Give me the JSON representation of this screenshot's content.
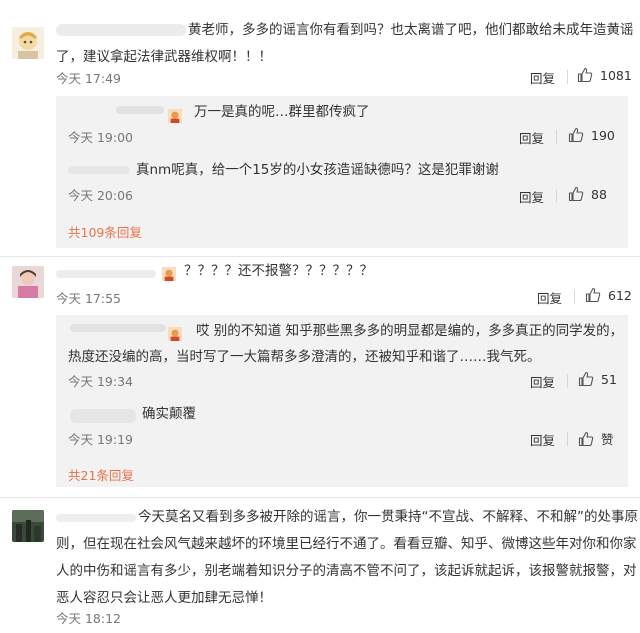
{
  "comments": [
    {
      "text_line1": "黄老师，多多的谣言你有看到吗？也太离谱了吧，他们都敢给未成年造黄谣",
      "text_line2": "了，建议拿起法律武器维权啊！！！",
      "time": "今天 17:49",
      "reply_label": "回复",
      "likes": "1081",
      "replies": [
        {
          "text": "万一是真的呢…群里都传疯了",
          "time": "今天 19:00",
          "reply_label": "回复",
          "likes": "190"
        },
        {
          "text": "真nm呢真，给一个15岁的小女孩造谣缺德吗？这是犯罪谢谢",
          "time": "今天 20:06",
          "reply_label": "回复",
          "likes": "88"
        }
      ],
      "more_replies": "共109条回复"
    },
    {
      "text_line1": "？？？？还不报警？？？？？？",
      "time": "今天 17:55",
      "reply_label": "回复",
      "likes": "612",
      "replies": [
        {
          "text_line1": "哎 别的不知道 知乎那些黑多多的明显都是编的，多多真正的同学发的，",
          "text_line2": "热度还没编的高，当时写了一大篇帮多多澄清的，还被知乎和谐了……我气死。",
          "time": "今天 19:34",
          "reply_label": "回复",
          "likes": "51"
        },
        {
          "text": "确实颠覆",
          "time": "今天 19:19",
          "reply_label": "回复",
          "likes": "赞"
        }
      ],
      "more_replies": "共21条回复"
    },
    {
      "text_line1": "今天莫名又看到多多被开除的谣言，你一贯秉持“不宣战、不解释、不和解”的处事原",
      "text_line2": "则，但在现在社会风气越来越坏的环境里已经行不通了。看看豆瓣、知乎、微博这些年对你和你家",
      "text_line3": "人的中伤和谣言有多少，别老端着知识分子的清高不管不问了，该起诉就起诉，该报警就报警，对",
      "text_line4": "恶人容忍只会让恶人更加肆无忌惮！",
      "time": "今天 18:12"
    }
  ],
  "colors": {
    "accent": "#e8734a",
    "subpanel": "#f2f2f2",
    "meta": "#777777"
  },
  "icons": {
    "like": "thumbs-up-icon"
  }
}
